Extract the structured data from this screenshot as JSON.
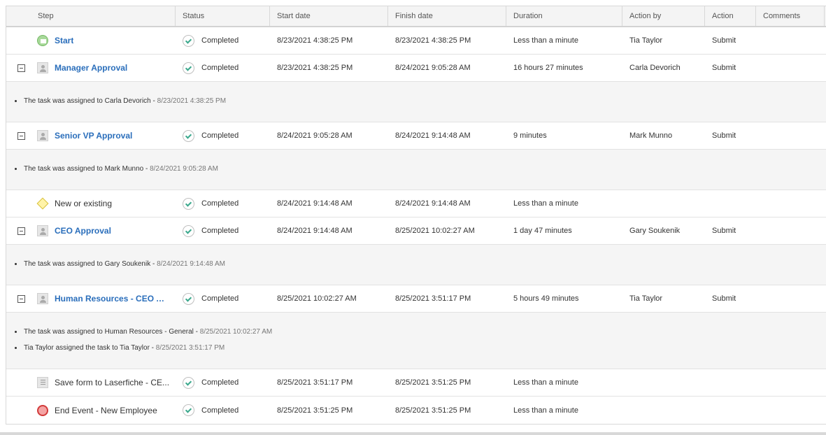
{
  "headers": {
    "step": "Step",
    "status": "Status",
    "start": "Start date",
    "finish": "Finish date",
    "duration": "Duration",
    "action_by": "Action by",
    "action": "Action",
    "comments": "Comments"
  },
  "rows": [
    {
      "step": "Start",
      "icon": "start-event-icon",
      "status": "Completed",
      "start": "8/23/2021 4:38:25 PM",
      "finish": "8/23/2021 4:38:25 PM",
      "duration": "Less than a minute",
      "action_by": "Tia Taylor",
      "action": "Submit"
    },
    {
      "step": "Manager Approval",
      "icon": "user-task-icon",
      "status": "Completed",
      "start": "8/23/2021 4:38:25 PM",
      "finish": "8/24/2021 9:05:28 AM",
      "duration": "16 hours 27 minutes",
      "action_by": "Carla Devorich",
      "action": "Submit",
      "notes": [
        {
          "text": "The task was assigned to Carla Devorich - ",
          "ts": "8/23/2021 4:38:25 PM"
        }
      ]
    },
    {
      "step": "Senior VP Approval",
      "icon": "user-task-icon",
      "status": "Completed",
      "start": "8/24/2021 9:05:28 AM",
      "finish": "8/24/2021 9:14:48 AM",
      "duration": "9 minutes",
      "action_by": "Mark Munno",
      "action": "Submit",
      "notes": [
        {
          "text": "The task was assigned to Mark Munno - ",
          "ts": "8/24/2021 9:05:28 AM"
        }
      ]
    },
    {
      "step": "New or existing",
      "icon": "gateway-icon",
      "status": "Completed",
      "start": "8/24/2021 9:14:48 AM",
      "finish": "8/24/2021 9:14:48 AM",
      "duration": "Less than a minute",
      "action_by": "",
      "action": ""
    },
    {
      "step": "CEO Approval",
      "icon": "user-task-icon",
      "status": "Completed",
      "start": "8/24/2021 9:14:48 AM",
      "finish": "8/25/2021 10:02:27 AM",
      "duration": "1 day 47 minutes",
      "action_by": "Gary Soukenik",
      "action": "Submit",
      "notes": [
        {
          "text": "The task was assigned to Gary Soukenik - ",
          "ts": "8/24/2021 9:14:48 AM"
        }
      ]
    },
    {
      "step": "Human Resources - CEO Ap...",
      "icon": "user-task-icon",
      "status": "Completed",
      "start": "8/25/2021 10:02:27 AM",
      "finish": "8/25/2021 3:51:17 PM",
      "duration": "5 hours 49 minutes",
      "action_by": "Tia Taylor",
      "action": "Submit",
      "notes": [
        {
          "text": "The task was assigned to Human Resources - General - ",
          "ts": "8/25/2021 10:02:27 AM"
        },
        {
          "text": "Tia Taylor assigned the task to Tia Taylor - ",
          "ts": "8/25/2021 3:51:17 PM"
        }
      ]
    },
    {
      "step": "Save form to Laserfiche - CE...",
      "icon": "service-task-icon",
      "status": "Completed",
      "start": "8/25/2021 3:51:17 PM",
      "finish": "8/25/2021 3:51:25 PM",
      "duration": "Less than a minute",
      "action_by": "",
      "action": ""
    },
    {
      "step": "End Event - New Employee",
      "icon": "end-event-icon",
      "status": "Completed",
      "start": "8/25/2021 3:51:25 PM",
      "finish": "8/25/2021 3:51:25 PM",
      "duration": "Less than a minute",
      "action_by": "",
      "action": ""
    }
  ]
}
